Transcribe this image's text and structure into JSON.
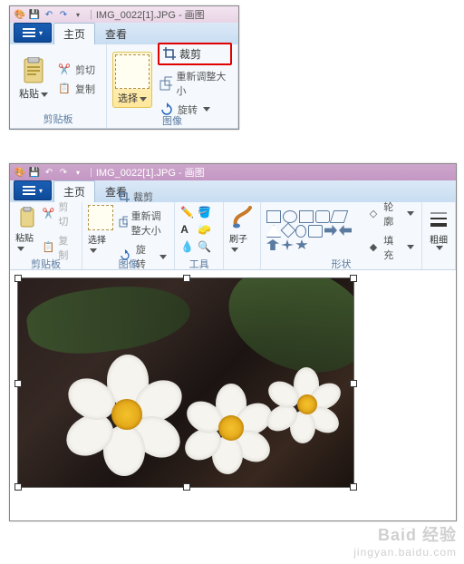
{
  "title_suffix": " - 画图",
  "filename": "IMG_0022[1].JPG",
  "tabs": {
    "home": "主页",
    "view": "查看"
  },
  "groups": {
    "clipboard": "剪贴板",
    "image": "图像",
    "tools": "工具",
    "shapes": "形状",
    "thickness": "粗细"
  },
  "clipboard": {
    "paste": "粘贴",
    "cut": "剪切",
    "copy": "复制"
  },
  "image": {
    "select": "选择",
    "crop": "裁剪",
    "resize": "重新调整大小",
    "rotate": "旋转"
  },
  "shapes_panel": {
    "outline": "轮廓",
    "fill": "填充"
  },
  "watermark": {
    "main": "Baid 经验",
    "sub": "jingyan.baidu.com"
  }
}
